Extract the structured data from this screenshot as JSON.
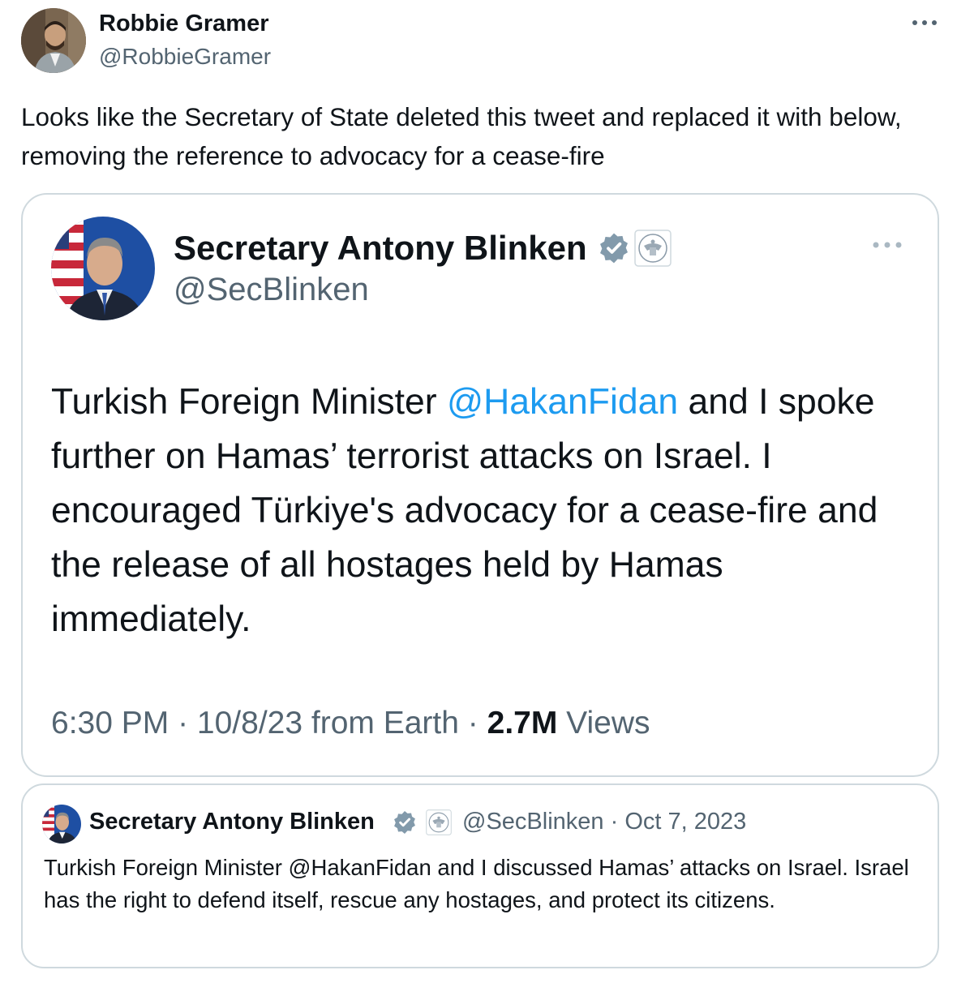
{
  "post": {
    "author": {
      "name": "Robbie Gramer",
      "handle": "@RobbieGramer"
    },
    "text": "Looks like the Secretary of State deleted this tweet and replaced it with below, removing the reference to advocacy for a cease-fire",
    "more_icon": "more-horizontal-icon"
  },
  "screenshot": {
    "author": {
      "name": "Secretary Antony Blinken",
      "handle": "@SecBlinken",
      "badges": [
        "verified-gray-badge-icon",
        "government-seal-icon"
      ]
    },
    "text_before_mention": "Turkish Foreign Minister ",
    "mention": "@HakanFidan",
    "text_after_mention": " and I spoke further on Hamas’ terrorist attacks on Israel. I encouraged Türkiye's advocacy for a cease-fire and the release of all hostages held by Hamas immediately.",
    "time": "6:30 PM",
    "date": "10/8/23",
    "source": "from Earth",
    "sep": " · ",
    "views_count": "2.7M",
    "views_label": "Views",
    "colors": {
      "mention": "#1d9bf0",
      "secondary_text": "#536471"
    }
  },
  "quote": {
    "author": {
      "name": "Secretary Antony Blinken",
      "handle": "@SecBlinken",
      "date": "Oct 7, 2023",
      "badges": [
        "verified-gray-badge-icon",
        "government-seal-icon"
      ]
    },
    "sep": " · ",
    "text": "Turkish Foreign Minister @HakanFidan and I discussed Hamas’ attacks on Israel. Israel has the right to defend itself, rescue any hostages, and protect its citizens."
  }
}
